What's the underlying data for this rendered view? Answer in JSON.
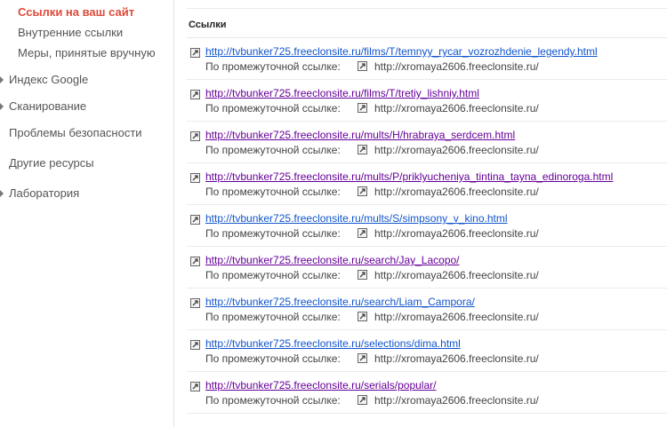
{
  "sidebar": {
    "sub_items": [
      {
        "label": "Ссылки на ваш сайт",
        "active": true
      },
      {
        "label": "Внутренние ссылки",
        "active": false
      },
      {
        "label": "Меры, принятые вручную",
        "active": false
      }
    ],
    "main_items": [
      {
        "label": "Индекс Google",
        "has_arrow": true
      },
      {
        "label": "Сканирование",
        "has_arrow": true
      },
      {
        "label": "Проблемы безопасности",
        "has_arrow": false
      },
      {
        "label": "Другие ресурсы",
        "has_arrow": false
      },
      {
        "label": "Лаборатория",
        "has_arrow": true
      }
    ]
  },
  "main": {
    "section_title": "Ссылки",
    "via_label": "По промежуточной ссылке:",
    "rows": [
      {
        "url": "http://tvbunker725.freeclonsite.ru/films/T/temnyy_rycar_vozrozhdenie_legendy.html",
        "via": "http://xromaya2606.freeclonsite.ru/",
        "visited": false
      },
      {
        "url": "http://tvbunker725.freeclonsite.ru/films/T/tretiy_lishniy.html",
        "via": "http://xromaya2606.freeclonsite.ru/",
        "visited": true
      },
      {
        "url": "http://tvbunker725.freeclonsite.ru/mults/H/hrabraya_serdcem.html",
        "via": "http://xromaya2606.freeclonsite.ru/",
        "visited": true
      },
      {
        "url": "http://tvbunker725.freeclonsite.ru/mults/P/priklyucheniya_tintina_tayna_edinoroga.html",
        "via": "http://xromaya2606.freeclonsite.ru/",
        "visited": true
      },
      {
        "url": "http://tvbunker725.freeclonsite.ru/mults/S/simpsony_v_kino.html",
        "via": "http://xromaya2606.freeclonsite.ru/",
        "visited": false
      },
      {
        "url": "http://tvbunker725.freeclonsite.ru/search/Jay_Lacopo/",
        "via": "http://xromaya2606.freeclonsite.ru/",
        "visited": true
      },
      {
        "url": "http://tvbunker725.freeclonsite.ru/search/Liam_Campora/",
        "via": "http://xromaya2606.freeclonsite.ru/",
        "visited": false
      },
      {
        "url": "http://tvbunker725.freeclonsite.ru/selections/dima.html",
        "via": "http://xromaya2606.freeclonsite.ru/",
        "visited": false
      },
      {
        "url": "http://tvbunker725.freeclonsite.ru/serials/popular/",
        "via": "http://xromaya2606.freeclonsite.ru/",
        "visited": true
      }
    ]
  },
  "colors": {
    "active_nav": "#dd4b39",
    "link": "#1155cc",
    "visited_link": "#660099",
    "text": "#444444"
  },
  "icons": {
    "nav_expand": "triangle-right-icon",
    "link_row": "external-link-icon"
  }
}
